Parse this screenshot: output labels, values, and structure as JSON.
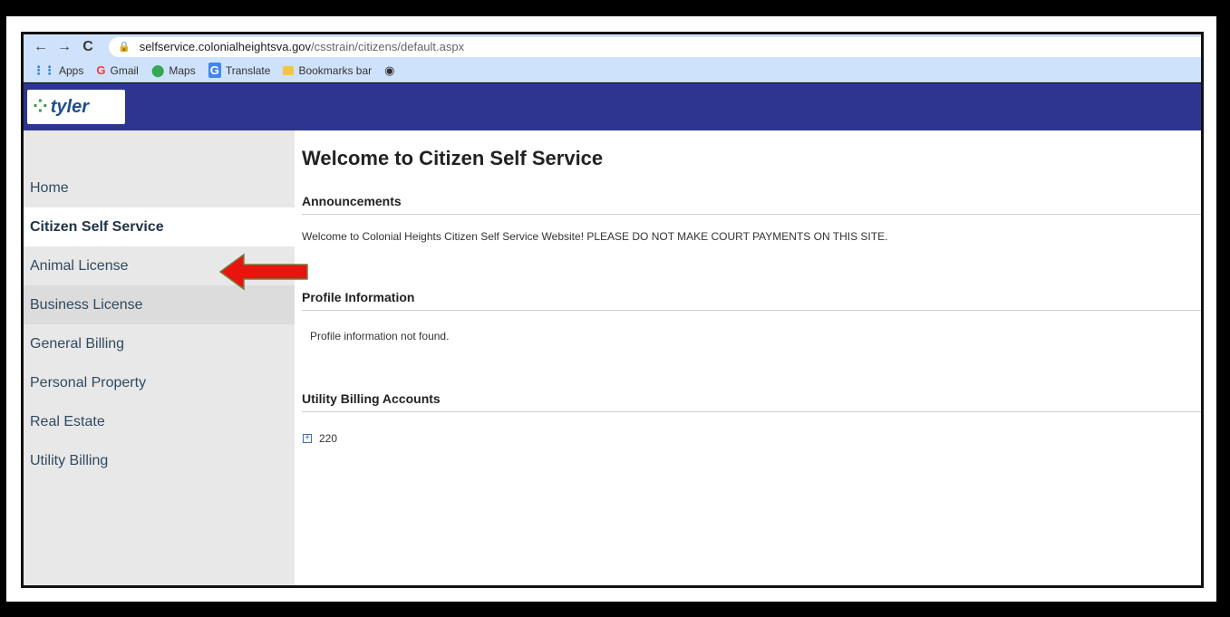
{
  "browser": {
    "url_host": "selfservice.colonialheightsva.gov",
    "url_path": "/csstrain/citizens/default.aspx",
    "bookmarks": [
      "Apps",
      "Gmail",
      "Maps",
      "Translate",
      "Bookmarks bar"
    ]
  },
  "header": {
    "logo_text": "tyler"
  },
  "sidebar": {
    "items": [
      {
        "label": "Home"
      },
      {
        "label": "Citizen Self Service"
      },
      {
        "label": "Animal License"
      },
      {
        "label": "Business License"
      },
      {
        "label": "General Billing"
      },
      {
        "label": "Personal Property"
      },
      {
        "label": "Real Estate"
      },
      {
        "label": "Utility Billing"
      }
    ]
  },
  "main": {
    "title": "Welcome to Citizen Self Service",
    "announcements": {
      "heading": "Announcements",
      "text": "Welcome to Colonial Heights Citizen Self Service Website! PLEASE DO NOT MAKE COURT PAYMENTS ON THIS SITE."
    },
    "profile": {
      "heading": "Profile Information",
      "text": "Profile information not found."
    },
    "utility": {
      "heading": "Utility Billing Accounts",
      "account": "220"
    }
  },
  "colors": {
    "header_bg": "#2e3591",
    "arrow": "#e8140e"
  }
}
